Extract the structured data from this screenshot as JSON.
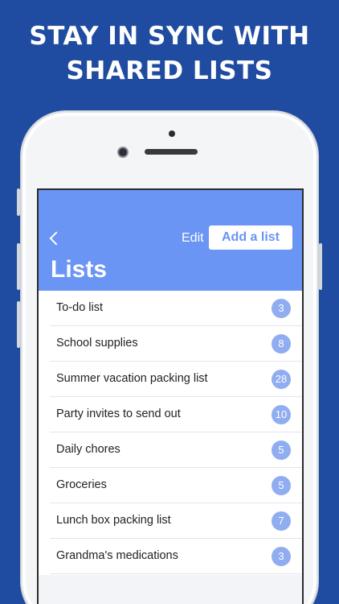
{
  "headline": {
    "line1": "STAY IN SYNC WITH",
    "line2": "SHARED LISTS"
  },
  "navbar": {
    "edit_label": "Edit",
    "add_label": "Add a list",
    "title": "Lists",
    "color": "#6a95f4"
  },
  "lists": [
    {
      "name": "To-do list",
      "count": "3"
    },
    {
      "name": "School supplies",
      "count": "8"
    },
    {
      "name": "Summer vacation packing list",
      "count": "28"
    },
    {
      "name": "Party invites to send out",
      "count": "10"
    },
    {
      "name": "Daily chores",
      "count": "5"
    },
    {
      "name": "Groceries",
      "count": "5"
    },
    {
      "name": "Lunch box packing list",
      "count": "7"
    },
    {
      "name": "Grandma's medications",
      "count": "3"
    }
  ],
  "colors": {
    "background": "#1f4ba0",
    "badge": "#8fadf0"
  }
}
